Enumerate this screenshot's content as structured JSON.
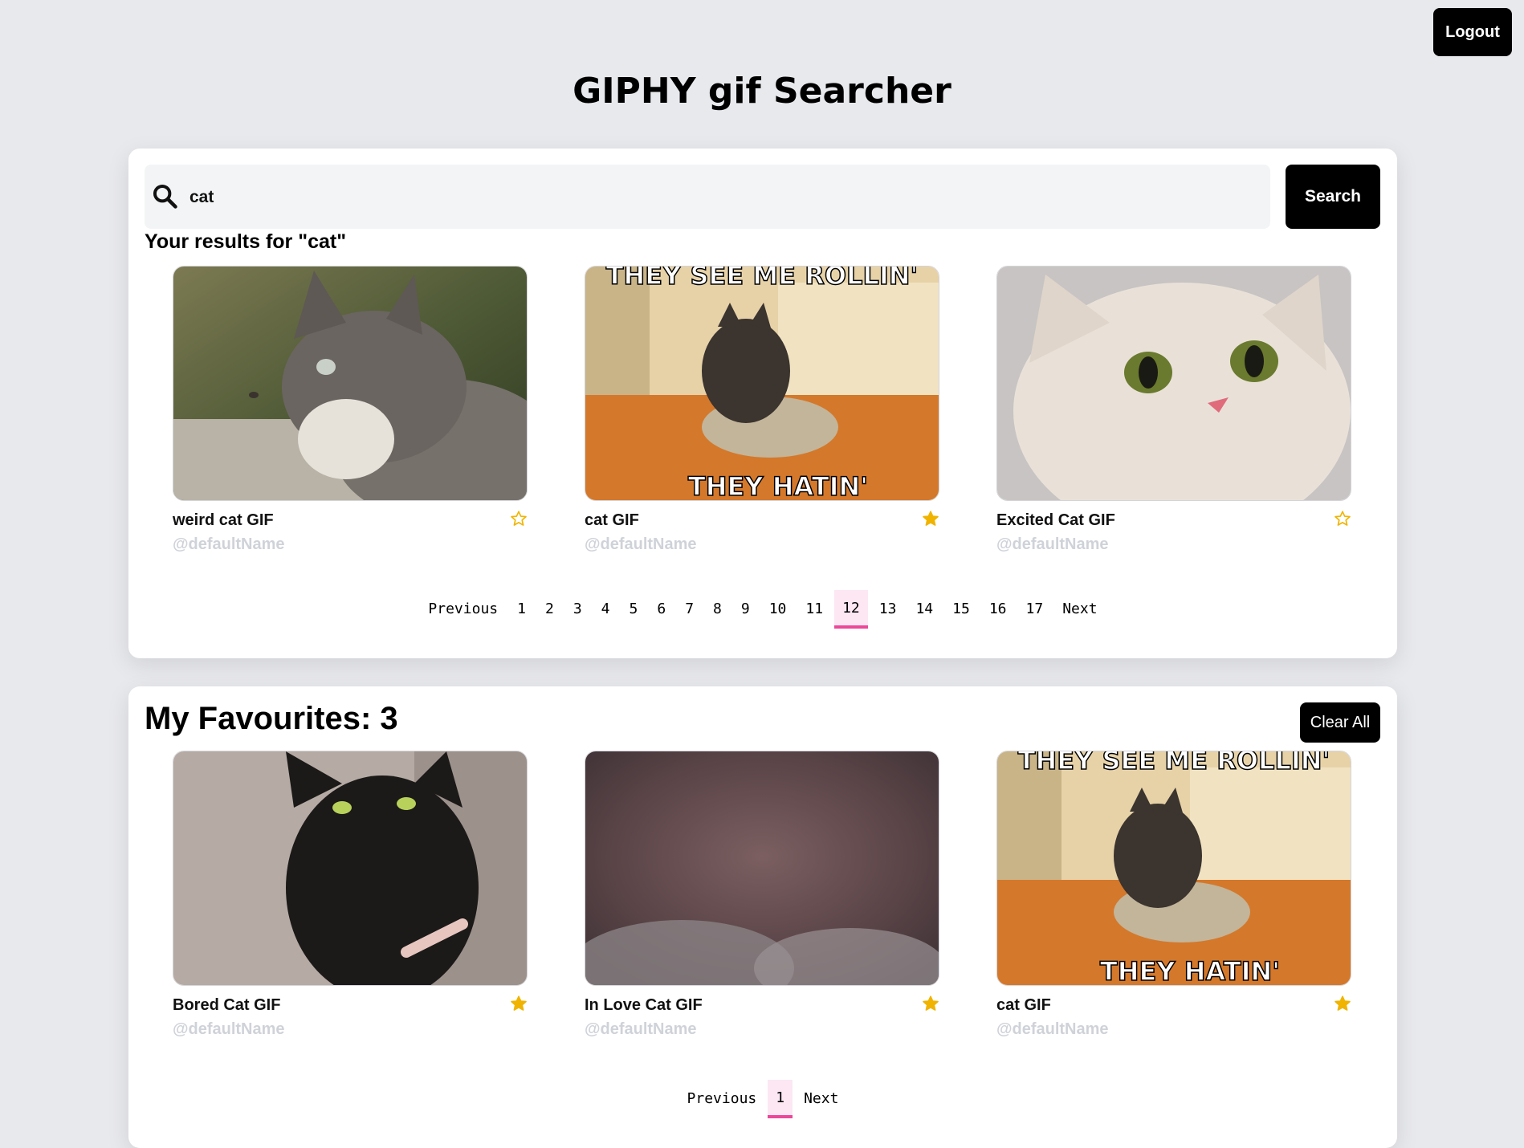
{
  "header": {
    "title": "GIPHY gif Searcher",
    "logout_label": "Logout"
  },
  "search": {
    "value": "cat",
    "button_label": "Search",
    "icon": "search-icon"
  },
  "results": {
    "heading": "Your results for \"cat\"",
    "items": [
      {
        "title": "weird cat GIF",
        "user": "@defaultName",
        "favourited": false
      },
      {
        "title": "cat GIF",
        "user": "@defaultName",
        "favourited": true
      },
      {
        "title": "Excited Cat GIF",
        "user": "@defaultName",
        "favourited": false
      }
    ],
    "pagination": {
      "previous": "Previous",
      "next": "Next",
      "pages": [
        "1",
        "2",
        "3",
        "4",
        "5",
        "6",
        "7",
        "8",
        "9",
        "10",
        "11",
        "12",
        "13",
        "14",
        "15",
        "16",
        "17"
      ],
      "current": "12"
    }
  },
  "favourites": {
    "title": "My Favourites: 3",
    "clear_label": "Clear All",
    "items": [
      {
        "title": "Bored Cat GIF",
        "user": "@defaultName",
        "favourited": true
      },
      {
        "title": "In Love Cat GIF",
        "user": "@defaultName",
        "favourited": true
      },
      {
        "title": "cat GIF",
        "user": "@defaultName",
        "favourited": true
      }
    ],
    "pagination": {
      "previous": "Previous",
      "next": "Next",
      "pages": [
        "1"
      ],
      "current": "1"
    }
  },
  "gif_captions": {
    "top": "THEY SEE ME ROLLIN'",
    "bottom": "THEY HATIN'"
  },
  "colors": {
    "star": "#f0b400",
    "active_page_bg": "#fce7f3",
    "active_page_border": "#ec4899"
  }
}
